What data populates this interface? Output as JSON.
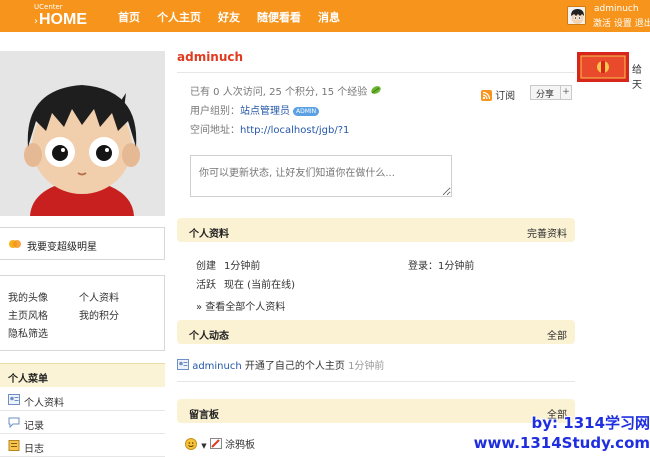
{
  "header": {
    "logo_small": "UCenter",
    "logo_big": "HOME",
    "nav": [
      "首页",
      "个人主页",
      "好友",
      "随便看看",
      "消息"
    ],
    "user_name": "adminuch",
    "user_links": [
      "激活",
      "设置",
      "退出"
    ]
  },
  "left": {
    "star_label": "我要变超级明星",
    "links": [
      "我的头像",
      "个人资料",
      "主页风格",
      "我的积分",
      "隐私筛选"
    ],
    "menu_title": "个人菜单",
    "menu_items": [
      "个人资料",
      "记录",
      "日志"
    ]
  },
  "main": {
    "username": "adminuch",
    "stats": "已有 0 人次访问, 25 个积分, 15 个经验",
    "usergroup_label": "用户组别：",
    "usergroup": "站点管理员",
    "badge": "ADMIN",
    "space_label": "空间地址：",
    "space_url": "http://localhost/jgb/?1",
    "subscribe": "订阅",
    "share": "分享",
    "share_plus": "+",
    "status_placeholder": "你可以更新状态, 让好友们知道你在做什么...",
    "profile": {
      "title": "个人资料",
      "action": "完善资料",
      "created_label": "创建",
      "created_value": "1分钟前",
      "login_label": "登录：",
      "login_value": "1分钟前",
      "active_label": "活跃",
      "active_value": "现在 (当前在线)",
      "more": "» 查看全部个人资料"
    },
    "feed": {
      "title": "个人动态",
      "action": "全部",
      "item_user": "adminuch",
      "item_text": " 开通了自己的个人主页 ",
      "item_time": "1分钟前"
    },
    "guestbook": {
      "title": "留言板",
      "action": "全部",
      "graffiti": "涂鸦板"
    }
  },
  "side": {
    "gift_text": "给天"
  },
  "watermark": {
    "line1": "by: 1314学习网",
    "line2": "www.1314Study.com"
  },
  "colors": {
    "topbar": "#f6941c",
    "accent_red": "#e03a1f",
    "panel_bg": "#fbf2d4",
    "link_blue": "#2558a8",
    "watermark_blue": "#1f2fe0"
  }
}
